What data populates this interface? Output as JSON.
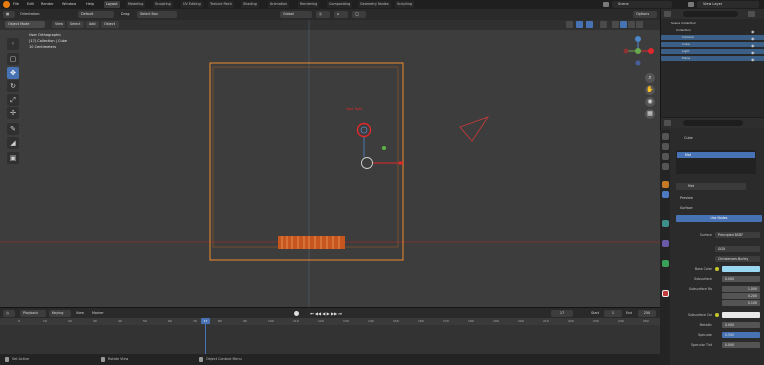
{
  "menu": [
    "File",
    "Edit",
    "Render",
    "Window",
    "Help"
  ],
  "workspaces": [
    "Layout",
    "Modeling",
    "Sculpting",
    "UV Editing",
    "Texture Paint",
    "Shading",
    "Animation",
    "Rendering",
    "Compositing",
    "Geometry Nodes",
    "Scripting"
  ],
  "active_workspace": "Layout",
  "scene": {
    "label": "Scene"
  },
  "view_layer": {
    "label": "View Layer"
  },
  "viewport_header": {
    "mode": "Object Mode",
    "menus": [
      "View",
      "Select",
      "Add",
      "Object"
    ],
    "orientation": "Global",
    "options": "Options",
    "transform_label": "Orientation:",
    "transform_value": "Default",
    "drag_label": "Drag:",
    "drag_value": "Select Box"
  },
  "overlay_info": [
    "User Orthographic",
    "(17) Collection | Cube",
    "10 Centimeters"
  ],
  "light_label": "Spot light",
  "outliner": {
    "title": "Scene Collection",
    "rows": [
      "Collection",
      "Camera",
      "Cube",
      "Light",
      "Plane"
    ]
  },
  "properties": {
    "object": "Cube",
    "material": "Mat",
    "material_slot": "Mat",
    "sections": [
      "Preview",
      "Surface"
    ],
    "use_nodes": "Use Nodes",
    "fields": [
      {
        "label": "Surface",
        "value": "Principled BSDF"
      },
      {
        "label": "",
        "value": "GGX"
      },
      {
        "label": "",
        "value": "Christensen-Burley"
      },
      {
        "label": "Base Color",
        "value": ""
      },
      {
        "label": "Subsurface",
        "value": "0.000"
      },
      {
        "label": "Subsurface Ra",
        "value": "1.000"
      },
      {
        "label": "",
        "value": "0.200"
      },
      {
        "label": "",
        "value": "0.100"
      },
      {
        "label": "Subsurface Col",
        "value": ""
      },
      {
        "label": "Metallic",
        "value": "0.000"
      },
      {
        "label": "Specular",
        "value": "0.500"
      },
      {
        "label": "Specular Tint",
        "value": "0.000"
      }
    ]
  },
  "timeline": {
    "menus": [
      "Playback",
      "Keying",
      "View",
      "Marker"
    ],
    "current_frame": "17",
    "start_label": "Start",
    "start": "1",
    "end_label": "End",
    "end": "250",
    "ticks": [
      "0",
      "10",
      "20",
      "30",
      "40",
      "50",
      "60",
      "70",
      "80",
      "90",
      "100",
      "110",
      "120",
      "130",
      "140",
      "150",
      "160",
      "170",
      "180",
      "190",
      "200",
      "210",
      "220",
      "230",
      "240",
      "250"
    ]
  },
  "statusbar": [
    "Set Active",
    "Rotate View",
    "Object Context Menu"
  ],
  "colors": {
    "accent": "#4772b3",
    "selection": "#f08c2a",
    "light": "#e0282d",
    "x_axis": "#8c3232",
    "y_axis": "#5a8a2a"
  }
}
